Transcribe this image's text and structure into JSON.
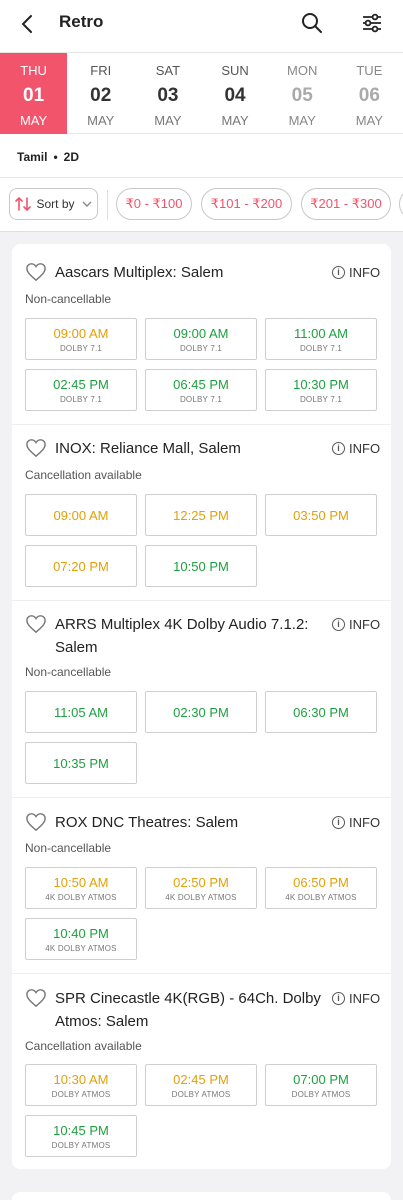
{
  "header": {
    "title": "Retro"
  },
  "dates": [
    {
      "dow": "THU",
      "num": "01",
      "mon": "MAY",
      "selected": true,
      "dim": false
    },
    {
      "dow": "FRI",
      "num": "02",
      "mon": "MAY",
      "selected": false,
      "dim": false
    },
    {
      "dow": "SAT",
      "num": "03",
      "mon": "MAY",
      "selected": false,
      "dim": false
    },
    {
      "dow": "SUN",
      "num": "04",
      "mon": "MAY",
      "selected": false,
      "dim": false
    },
    {
      "dow": "MON",
      "num": "05",
      "mon": "MAY",
      "selected": false,
      "dim": true
    },
    {
      "dow": "TUE",
      "num": "06",
      "mon": "MAY",
      "selected": false,
      "dim": true
    }
  ],
  "filters": {
    "language": "Tamil",
    "format": "2D",
    "sort_label": "Sort by",
    "price_chips": [
      "₹0 - ₹100",
      "₹101 - ₹200",
      "₹201 - ₹300"
    ]
  },
  "info_label": "INFO",
  "venues": [
    {
      "name": "Aascars Multiplex: Salem",
      "policy": "Non-cancellable",
      "showtimes": [
        {
          "time": "09:00 AM",
          "format": "DOLBY 7.1",
          "status": "yellow"
        },
        {
          "time": "09:00 AM",
          "format": "DOLBY 7.1",
          "status": "green"
        },
        {
          "time": "11:00 AM",
          "format": "DOLBY 7.1",
          "status": "green"
        },
        {
          "time": "02:45 PM",
          "format": "DOLBY 7.1",
          "status": "green"
        },
        {
          "time": "06:45 PM",
          "format": "DOLBY 7.1",
          "status": "green"
        },
        {
          "time": "10:30 PM",
          "format": "DOLBY 7.1",
          "status": "green"
        }
      ]
    },
    {
      "name": "INOX: Reliance Mall, Salem",
      "policy": "Cancellation available",
      "showtimes": [
        {
          "time": "09:00 AM",
          "format": "",
          "status": "yellow"
        },
        {
          "time": "12:25 PM",
          "format": "",
          "status": "yellow"
        },
        {
          "time": "03:50 PM",
          "format": "",
          "status": "yellow"
        },
        {
          "time": "07:20 PM",
          "format": "",
          "status": "yellow"
        },
        {
          "time": "10:50 PM",
          "format": "",
          "status": "green"
        }
      ]
    },
    {
      "name_line1": "ARRS Multiplex 4K Dolby Audio 7.1.2:",
      "name_line2": "Salem",
      "policy": "Non-cancellable",
      "showtimes": [
        {
          "time": "11:05 AM",
          "format": "",
          "status": "green"
        },
        {
          "time": "02:30 PM",
          "format": "",
          "status": "green"
        },
        {
          "time": "06:30 PM",
          "format": "",
          "status": "green"
        },
        {
          "time": "10:35 PM",
          "format": "",
          "status": "green"
        }
      ]
    },
    {
      "name": "ROX DNC Theatres: Salem",
      "policy": "Non-cancellable",
      "showtimes": [
        {
          "time": "10:50 AM",
          "format": "4K DOLBY ATMOS",
          "status": "yellow"
        },
        {
          "time": "02:50 PM",
          "format": "4K DOLBY ATMOS",
          "status": "yellow"
        },
        {
          "time": "06:50 PM",
          "format": "4K DOLBY ATMOS",
          "status": "yellow"
        },
        {
          "time": "10:40 PM",
          "format": "4K DOLBY ATMOS",
          "status": "green"
        }
      ]
    },
    {
      "name_line1": "SPR Cinecastle 4K(RGB) - 64Ch. Dolby",
      "name_line2": "Atmos: Salem",
      "policy": "Cancellation available",
      "showtimes": [
        {
          "time": "10:30 AM",
          "format": "DOLBY ATMOS",
          "status": "yellow"
        },
        {
          "time": "02:45 PM",
          "format": "DOLBY ATMOS",
          "status": "yellow"
        },
        {
          "time": "07:00 PM",
          "format": "DOLBY ATMOS",
          "status": "green"
        },
        {
          "time": "10:45 PM",
          "format": "DOLBY ATMOS",
          "status": "green"
        }
      ]
    }
  ],
  "colors": {
    "accent": "#f2546b",
    "almost_full": "#e3a007",
    "available": "#1ea03f"
  }
}
